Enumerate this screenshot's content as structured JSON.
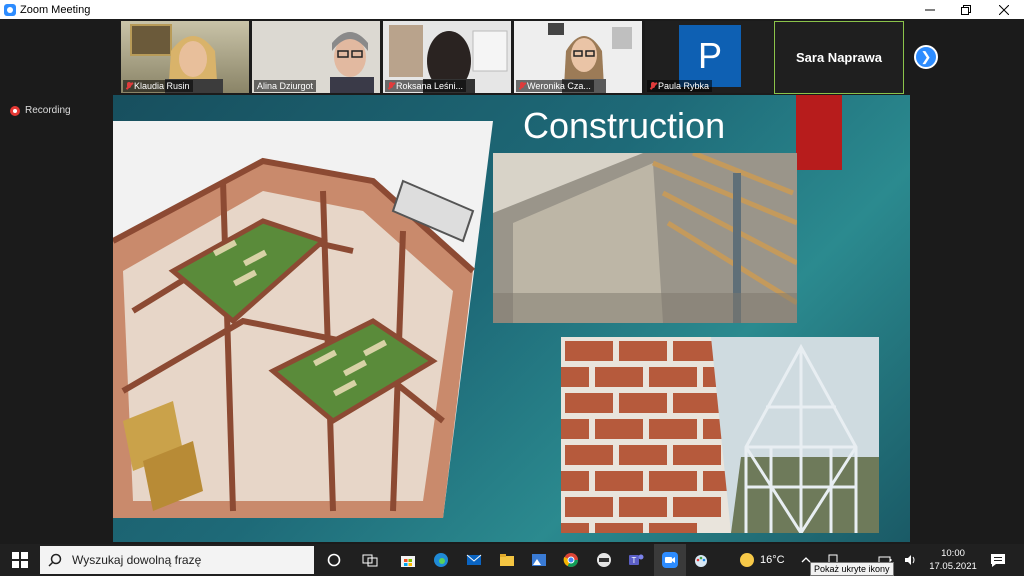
{
  "window": {
    "title": "Zoom Meeting"
  },
  "participants": [
    {
      "name": "Klaudia Rusin",
      "muted": true
    },
    {
      "name": "Alina Dziurgot",
      "muted": false
    },
    {
      "name": "Roksana Leśni...",
      "muted": true
    },
    {
      "name": "Weronika Cza...",
      "muted": true
    },
    {
      "name": "Paula Rybka",
      "muted": true,
      "avatar_letter": "P"
    }
  ],
  "active_speaker": {
    "name": "Sara Naprawa"
  },
  "recording": {
    "label": "Recording"
  },
  "slide": {
    "title": "Construction"
  },
  "taskbar": {
    "search_placeholder": "Wyszukaj dowolną frazę",
    "temperature": "16°C",
    "time": "10:00",
    "date": "17.05.2021",
    "tooltip": "Pokaż ukryte ikony"
  },
  "colors": {
    "zoom_blue": "#2d8cff",
    "slide_red": "#b71c1c",
    "speaker_border": "#8bc34a"
  }
}
